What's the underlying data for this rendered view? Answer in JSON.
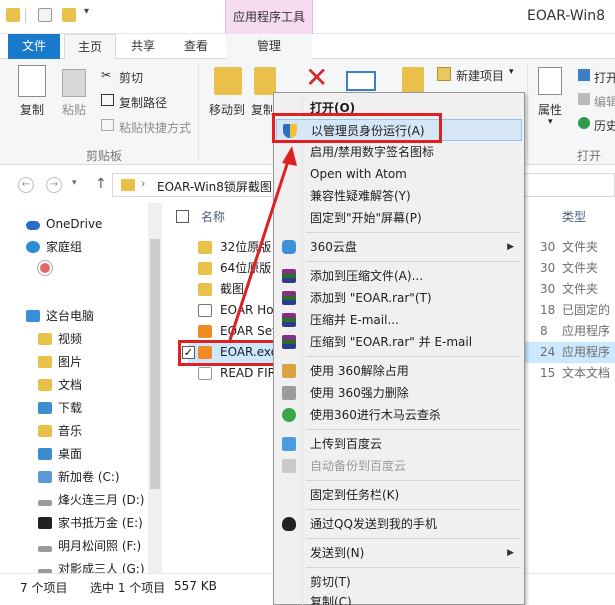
{
  "titlebar": {
    "contextual_tab_header": "应用程序工具",
    "window_title": "EOAR-Win8"
  },
  "tabs": {
    "file": "文件",
    "home": "主页",
    "share": "共享",
    "view": "查看",
    "manage": "管理"
  },
  "ribbon": {
    "copy": "复制",
    "paste": "粘贴",
    "cut": "剪切",
    "copy_path": "复制路径",
    "paste_shortcut": "粘贴快捷方式",
    "clipboard_group": "剪贴板",
    "move_to": "移动到",
    "copy_to": "复制",
    "new_item": "新建项目",
    "properties": "属性",
    "open_group": "打开",
    "open": "打开",
    "edit": "编辑",
    "history": "历史"
  },
  "address": {
    "path": "EOAR-Win8锁屏截图"
  },
  "nav": {
    "items": [
      {
        "label": "OneDrive",
        "icon": "cloud-icon"
      },
      {
        "label": "家庭组",
        "icon": "homegroup-icon"
      },
      {
        "label": "这台电脑",
        "icon": "computer-icon"
      },
      {
        "label": "视频",
        "icon": "video-folder-icon"
      },
      {
        "label": "图片",
        "icon": "pictures-folder-icon"
      },
      {
        "label": "文档",
        "icon": "documents-folder-icon"
      },
      {
        "label": "下载",
        "icon": "downloads-folder-icon"
      },
      {
        "label": "音乐",
        "icon": "music-folder-icon"
      },
      {
        "label": "桌面",
        "icon": "desktop-folder-icon"
      },
      {
        "label": "新加卷 (C:)",
        "icon": "drive-icon"
      },
      {
        "label": "烽火连三月 (D:)",
        "icon": "drive-icon"
      },
      {
        "label": "家书抵万金 (E:)",
        "icon": "drive-icon"
      },
      {
        "label": "明月松间照 (F:)",
        "icon": "drive-icon"
      },
      {
        "label": "对影成三人 (G:)",
        "icon": "drive-icon"
      }
    ]
  },
  "files": {
    "headers": {
      "name": "名称",
      "type": "类型"
    },
    "rows": [
      {
        "name": "32位原版",
        "date": "30",
        "type": "文件夹",
        "icon": "folder-icon"
      },
      {
        "name": "64位原版",
        "date": "30",
        "type": "文件夹",
        "icon": "folder-icon"
      },
      {
        "name": "截图",
        "date": "30",
        "type": "文件夹",
        "icon": "folder-icon"
      },
      {
        "name": "EOAR Hor",
        "date": "18",
        "type": "已固定的",
        "icon": "shortcut-icon"
      },
      {
        "name": "EOAR Set",
        "date": "8",
        "type": "应用程序",
        "icon": "app-icon"
      },
      {
        "name": "EOAR.exe",
        "date": "24",
        "type": "应用程序",
        "icon": "app-icon"
      },
      {
        "name": "READ FIRS",
        "date": "15",
        "type": "文本文档",
        "icon": "text-file-icon"
      }
    ]
  },
  "status": {
    "item_count": "7 个项目",
    "selection": "选中 1 个项目",
    "size": "557 KB"
  },
  "context_menu": {
    "items": [
      {
        "label": "打开(O)",
        "bold": true
      },
      {
        "label": "以管理员身份运行(A)",
        "icon": "shield-icon"
      },
      {
        "label": "启用/禁用数字签名图标"
      },
      {
        "label": "Open with Atom"
      },
      {
        "label": "兼容性疑难解答(Y)"
      },
      {
        "label": "固定到\"开始\"屏幕(P)"
      },
      {
        "label": "360云盘",
        "icon": "cloud-disk-icon"
      },
      {
        "label": "添加到压缩文件(A)...",
        "icon": "archive-icon"
      },
      {
        "label": "添加到 \"EOAR.rar\"(T)",
        "icon": "archive-icon"
      },
      {
        "label": "压缩并 E-mail...",
        "icon": "archive-icon"
      },
      {
        "label": "压缩到 \"EOAR.rar\" 并 E-mail",
        "icon": "archive-icon"
      },
      {
        "label": "使用 360解除占用",
        "icon": "unlock-icon"
      },
      {
        "label": "使用 360强力删除",
        "icon": "delete-icon"
      },
      {
        "label": "使用360进行木马云查杀",
        "icon": "virus-scan-icon"
      },
      {
        "label": "上传到百度云",
        "icon": "baidu-cloud-icon"
      },
      {
        "label": "自动备份到百度云",
        "icon": "baidu-backup-icon"
      },
      {
        "label": "固定到任务栏(K)"
      },
      {
        "label": "通过QQ发送到我的手机",
        "icon": "qq-icon"
      },
      {
        "label": "发送到(N)"
      },
      {
        "label": "剪切(T)"
      },
      {
        "label": "复制(C)"
      }
    ]
  }
}
